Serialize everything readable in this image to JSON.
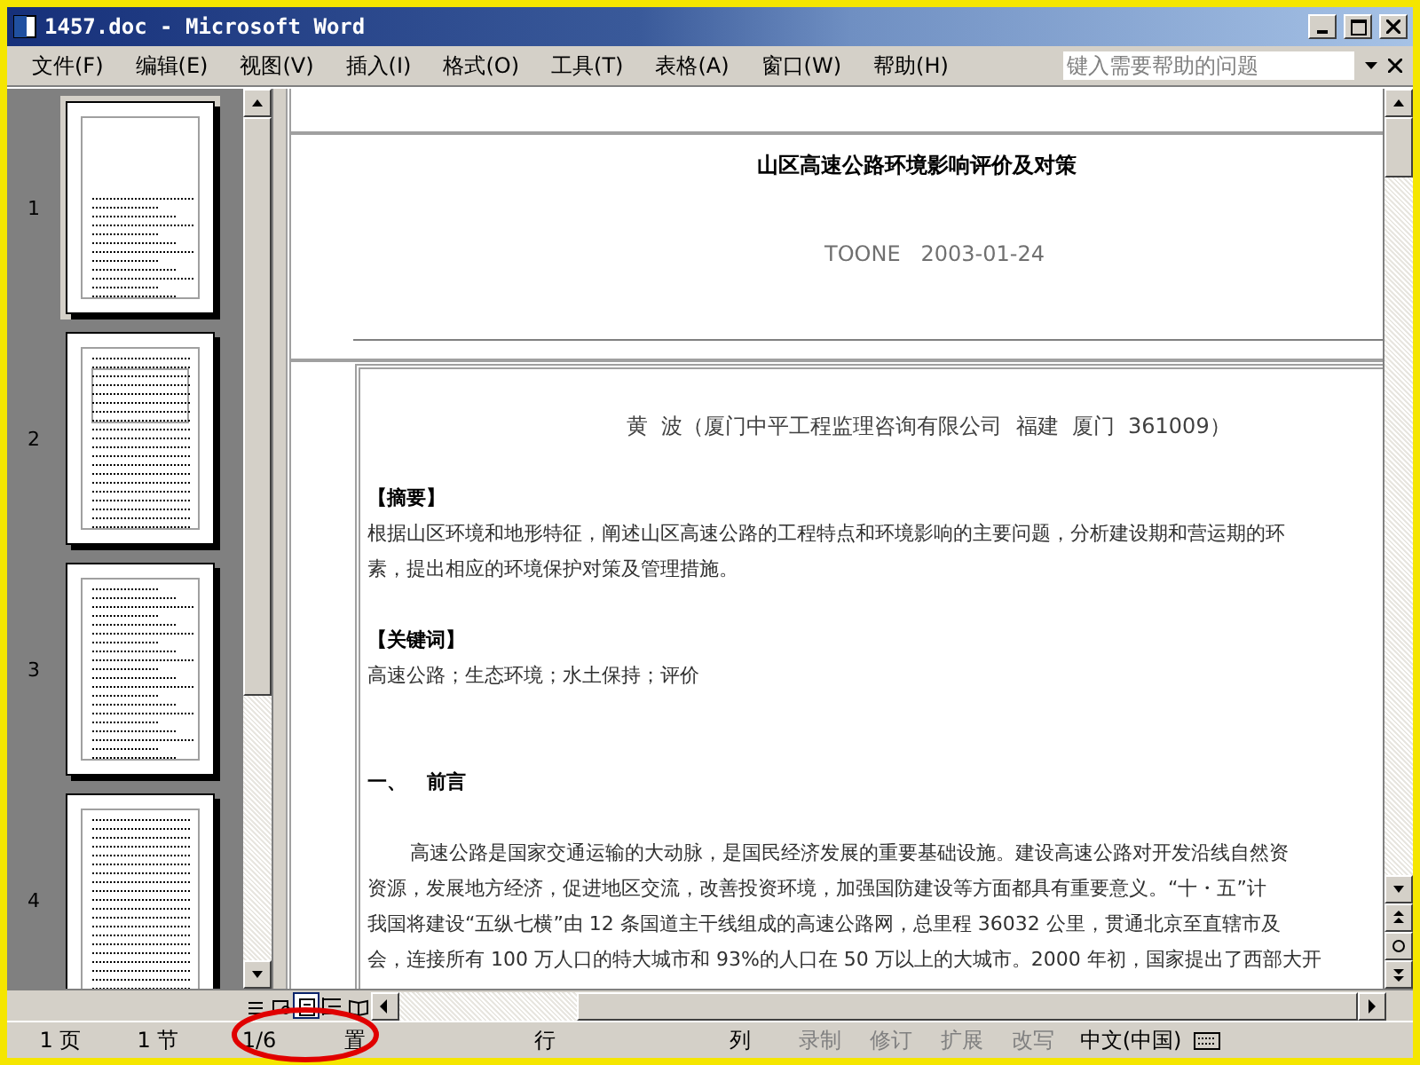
{
  "window": {
    "title": "1457.doc - Microsoft Word"
  },
  "menu": [
    "文件(F)",
    "编辑(E)",
    "视图(V)",
    "插入(I)",
    "格式(O)",
    "工具(T)",
    "表格(A)",
    "窗口(W)",
    "帮助(H)"
  ],
  "help_box": {
    "placeholder": "键入需要帮助的问题"
  },
  "thumbnails": [
    {
      "label": "1",
      "selected": true
    },
    {
      "label": "2",
      "selected": false
    },
    {
      "label": "3",
      "selected": false
    },
    {
      "label": "4",
      "selected": false
    }
  ],
  "document": {
    "title": "山区高速公路环境影响评价及对策",
    "byline": "TOONE   2003-01-24",
    "author": "黄  波（厦门中平工程监理咨询有限公司  福建  厦门  361009）",
    "blocks": [
      {
        "kind": "heading",
        "text": "【摘要】"
      },
      {
        "kind": "line",
        "text": "根据山区环境和地形特征，阐述山区高速公路的工程特点和环境影响的主要问题，分析建设期和营运期的环"
      },
      {
        "kind": "line",
        "text": "素，提出相应的环境保护对策及管理措施。"
      },
      {
        "kind": "gap"
      },
      {
        "kind": "heading",
        "text": "【关键词】"
      },
      {
        "kind": "line",
        "text": "高速公路；生态环境；水土保持；评价"
      },
      {
        "kind": "gap"
      },
      {
        "kind": "gap"
      },
      {
        "kind": "section",
        "text": "一、   前言"
      },
      {
        "kind": "gap"
      },
      {
        "kind": "indent",
        "text": "高速公路是国家交通运输的大动脉，是国民经济发展的重要基础设施。建设高速公路对开发沿线自然资"
      },
      {
        "kind": "line",
        "text": "资源，发展地方经济，促进地区交流，改善投资环境，加强国防建设等方面都具有重要意义。“十・五”计"
      },
      {
        "kind": "line",
        "text": "我国将建设“五纵七横”由 12 条国道主干线组成的高速公路网，总里程 36032 公里，贯通北京至直辖市及"
      },
      {
        "kind": "line",
        "text": "会，连接所有 100 万人口的特大城市和 93%的人口在 50 万以上的大城市。2000 年初，国家提出了西部大开"
      }
    ]
  },
  "view_buttons": [
    {
      "kind": "normal",
      "selected": false
    },
    {
      "kind": "web",
      "selected": false
    },
    {
      "kind": "print",
      "selected": true
    },
    {
      "kind": "outline",
      "selected": false
    },
    {
      "kind": "reading",
      "selected": false
    }
  ],
  "status_bar": [
    {
      "text": "1 页",
      "disabled": false
    },
    {
      "text": "1 节",
      "disabled": false
    },
    {
      "text": "1/6",
      "disabled": false
    },
    {
      "text": "置",
      "disabled": false
    },
    {
      "text": "行",
      "disabled": false
    },
    {
      "text": "列",
      "disabled": false
    },
    {
      "text": "录制",
      "disabled": true
    },
    {
      "text": "修订",
      "disabled": true
    },
    {
      "text": "扩展",
      "disabled": true
    },
    {
      "text": "改写",
      "disabled": true
    },
    {
      "text": "中文(中国)",
      "disabled": false
    }
  ]
}
